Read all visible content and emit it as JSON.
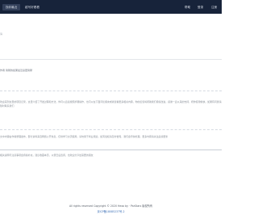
{
  "nav": {
    "active_item": "找你最近",
    "item_2": "越写好看看",
    "right_items": [
      "帮助",
      "登录",
      "注册"
    ]
  },
  "input": {
    "placeholder": "请"
  },
  "meta_text": "作者 简陋的如果最近读更简陋",
  "paragraphs": [
    "欢迎来到这里的项目记录，这里介绍了开发过程和方法，你可以直接按照步骤操作，也可以在下面评论留言或者查看更多相关内容，你的反馈将帮助我们持续改进，感谢一直以来的支持，祝你使用愉快，如果有问题请随时联系我们",
    "文中内容由作者整理发布，部分资料来自网络公开信息，仅供学习交流使用，请勿用于商业用途，如有侵权请及时告知，我们会尽快处理，更多内容请关注后续更新",
    "相关说明与注意事项会持续补充，建议收藏本页，以便日后查阅，也欢迎分享给需要的朋友"
  ],
  "footer": {
    "copyright": "All rights reserved Copyright © 2020 Hexo by · ParStars 版权所有",
    "icp": "京ICP备18085237号-2"
  }
}
